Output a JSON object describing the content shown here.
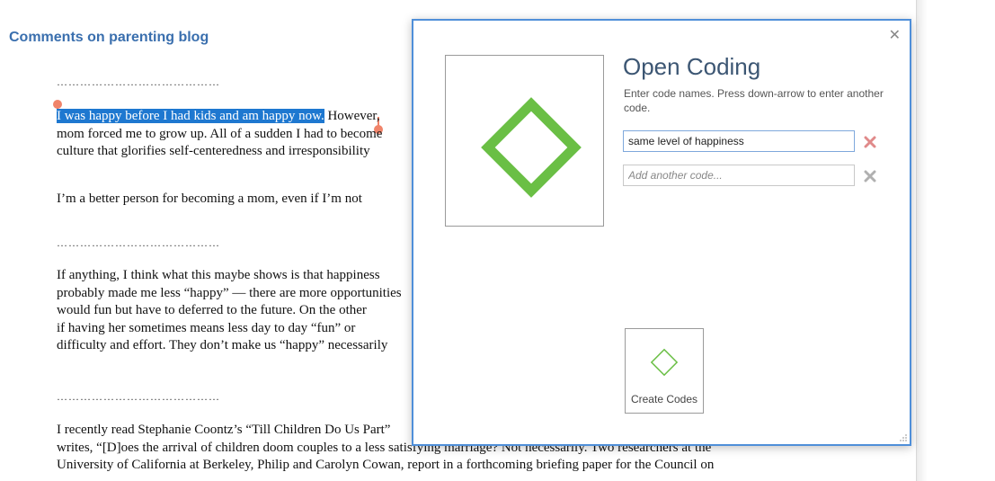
{
  "document": {
    "heading": "Comments on parenting blog",
    "separator": "……………………………………",
    "paragraphs": [
      {
        "lines": [
          {
            "highlight": "I was happy before I had kids and am happy now.",
            "rest": " However,"
          },
          {
            "text": "mom forced me to grow up. All of a sudden I had to become"
          },
          {
            "text": "culture that glorifies self-centeredness and irresponsibility"
          }
        ]
      },
      {
        "lines": [
          {
            "text": "I’m a better person for becoming a mom, even if I’m not"
          }
        ]
      },
      {
        "lines": [
          {
            "text": "If anything, I think what this maybe shows is that happiness"
          },
          {
            "text": "probably made me less “happy” — there are more opportunities"
          },
          {
            "text": "would fun but have to deferred to the future. On the other"
          },
          {
            "text": "if having her sometimes means less day to day “fun” or"
          },
          {
            "text": "difficulty and effort. They don’t make us “happy” necessarily"
          }
        ]
      },
      {
        "lines": [
          {
            "text": "I recently read Stephanie Coontz’s “Till Children Do Us Part”"
          },
          {
            "text": "writes, “[D]oes the arrival of children doom couples to a less satisfying marriage? Not necessarily. Two researchers at the"
          },
          {
            "text": "University of California at Berkeley, Philip and Carolyn Cowan, report in a forthcoming briefing paper for the Council on"
          }
        ]
      }
    ]
  },
  "modal": {
    "title": "Open Coding",
    "instructions": "Enter code names. Press down-arrow to enter another code.",
    "codes": [
      {
        "value": "same level of happiness",
        "placeholder": ""
      },
      {
        "value": "",
        "placeholder": "Add another code..."
      }
    ],
    "create_button_label": "Create Codes",
    "close_icon": "close-icon",
    "accent_green": "#6abf45",
    "border_blue": "#4f8fd9"
  }
}
